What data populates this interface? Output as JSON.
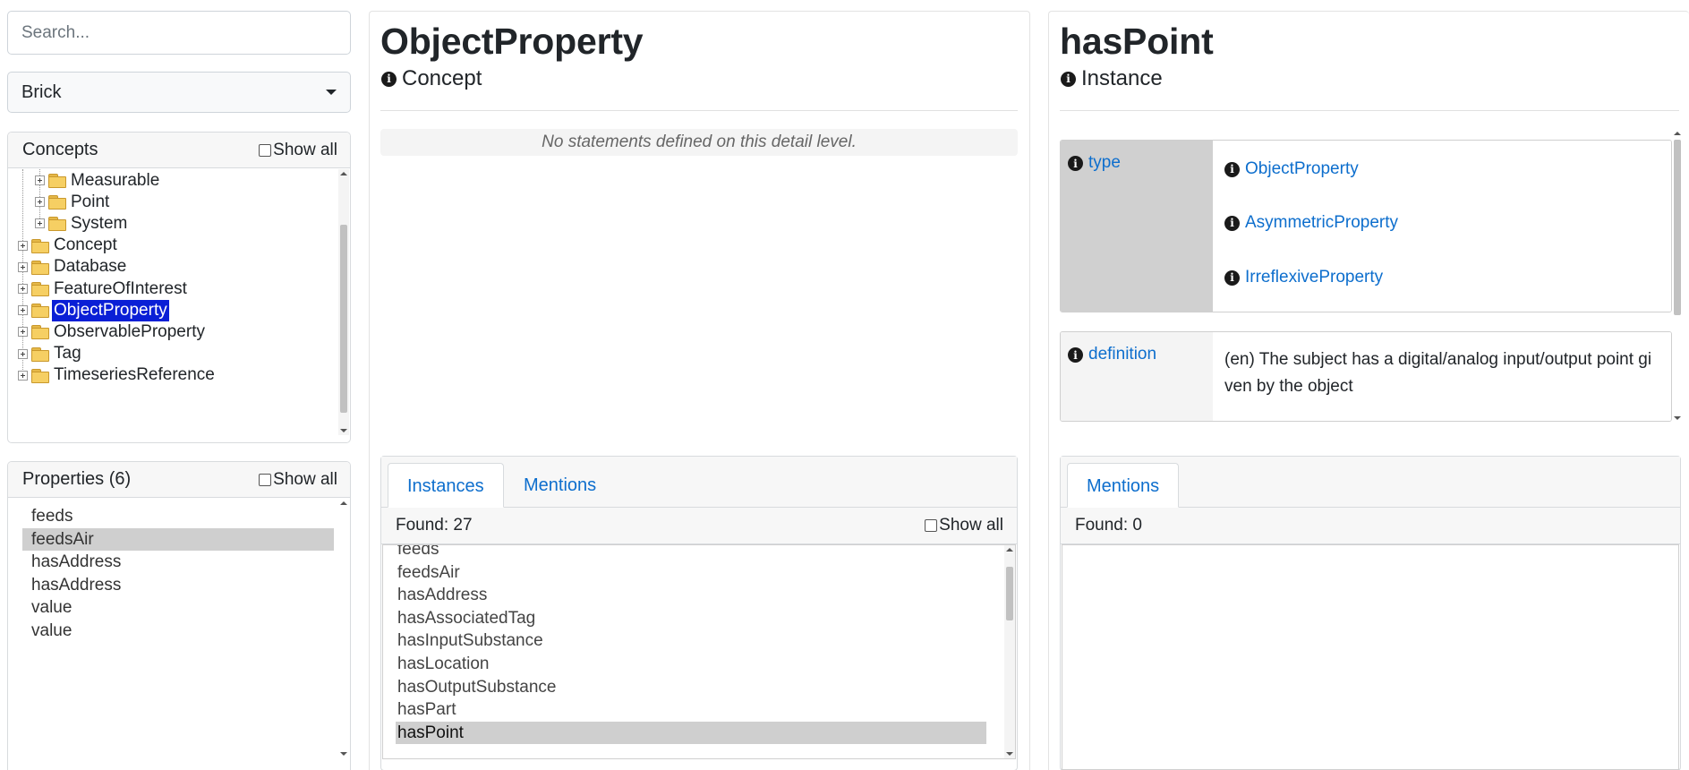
{
  "search": {
    "placeholder": "Search..."
  },
  "vocab_select": {
    "value": "Brick"
  },
  "concepts": {
    "title": "Concepts",
    "show_all": "Show all",
    "tree": [
      {
        "label": "Measurable",
        "level": 1,
        "selected": false
      },
      {
        "label": "Point",
        "level": 1,
        "selected": false
      },
      {
        "label": "System",
        "level": 1,
        "selected": false
      },
      {
        "label": "Concept",
        "level": 0,
        "selected": false
      },
      {
        "label": "Database",
        "level": 0,
        "selected": false
      },
      {
        "label": "FeatureOfInterest",
        "level": 0,
        "selected": false
      },
      {
        "label": "ObjectProperty",
        "level": 0,
        "selected": true
      },
      {
        "label": "ObservableProperty",
        "level": 0,
        "selected": false
      },
      {
        "label": "Tag",
        "level": 0,
        "selected": false
      },
      {
        "label": "TimeseriesReference",
        "level": 0,
        "selected": false
      }
    ]
  },
  "properties": {
    "title": "Properties (6)",
    "show_all": "Show all",
    "items": [
      {
        "label": "feeds",
        "selected": false
      },
      {
        "label": "feedsAir",
        "selected": true
      },
      {
        "label": "hasAddress",
        "selected": false
      },
      {
        "label": "hasAddress",
        "selected": false
      },
      {
        "label": "value",
        "selected": false
      },
      {
        "label": "value",
        "selected": false
      }
    ]
  },
  "middle": {
    "title": "ObjectProperty",
    "kind": "Concept",
    "no_statements": "No statements defined on this detail level.",
    "tabs": [
      {
        "label": "Instances",
        "active": true
      },
      {
        "label": "Mentions",
        "active": false
      }
    ],
    "found": "Found: 27",
    "show_all": "Show all",
    "instances": [
      {
        "label": "feeds",
        "selected": false
      },
      {
        "label": "feedsAir",
        "selected": false
      },
      {
        "label": "hasAddress",
        "selected": false
      },
      {
        "label": "hasAssociatedTag",
        "selected": false
      },
      {
        "label": "hasInputSubstance",
        "selected": false
      },
      {
        "label": "hasLocation",
        "selected": false
      },
      {
        "label": "hasOutputSubstance",
        "selected": false
      },
      {
        "label": "hasPart",
        "selected": false
      },
      {
        "label": "hasPoint",
        "selected": true
      }
    ]
  },
  "right": {
    "title": "hasPoint",
    "kind": "Instance",
    "statements": {
      "type": {
        "key": "type",
        "values": [
          "ObjectProperty",
          "AsymmetricProperty",
          "IrreflexiveProperty"
        ]
      },
      "definition": {
        "key": "definition",
        "text": "(en) The subject has a digital/analog input/output point given by the object"
      }
    },
    "tabs": [
      {
        "label": "Mentions",
        "active": true
      }
    ],
    "found": "Found: 0"
  },
  "icons": {
    "info": "info-icon",
    "folder": "folder-icon",
    "expand": "plus-box-icon",
    "dropdown": "chevron-down-icon"
  },
  "colors": {
    "link": "#0d6ecd",
    "tree_selection": "#0a1fd6",
    "list_selection": "#cfcfcf"
  }
}
